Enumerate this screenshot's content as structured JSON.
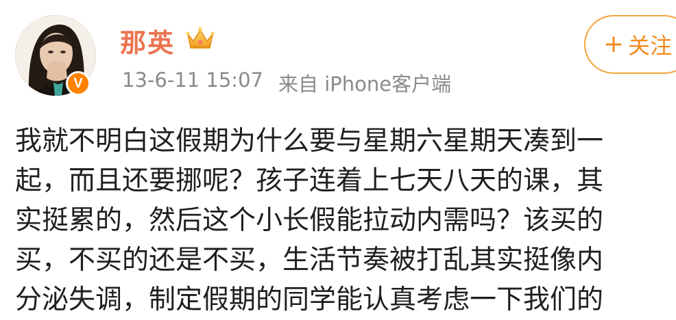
{
  "post": {
    "author": {
      "name": "那英",
      "avatar_icon": "avatar-photo",
      "crown_icon": "crown-icon",
      "verified_icon": "verified-v-icon",
      "verified_label": "V"
    },
    "timestamp": "13-6-11 15:07",
    "source": "来自 iPhone客户端",
    "follow_label": "关注",
    "follow_plus": "+",
    "body_lines": [
      "我就不明白这假期为什么要与星期六星期天凑到一",
      "起，而且还要挪呢？孩子连着上七天八天的课，其",
      "实挺累的，然后这个小长假能拉动内需吗？该买的",
      "买，不买的还是不买，生活节奏被打乱其实挺像内",
      "分泌失调，制定假期的同学能认真考虑一下我们的"
    ]
  },
  "colors": {
    "username": "#eb7350",
    "follow_border": "#f2a33a",
    "follow_text": "#f28a1a",
    "meta": "#8a8a8a",
    "badge": "#ff8200"
  }
}
